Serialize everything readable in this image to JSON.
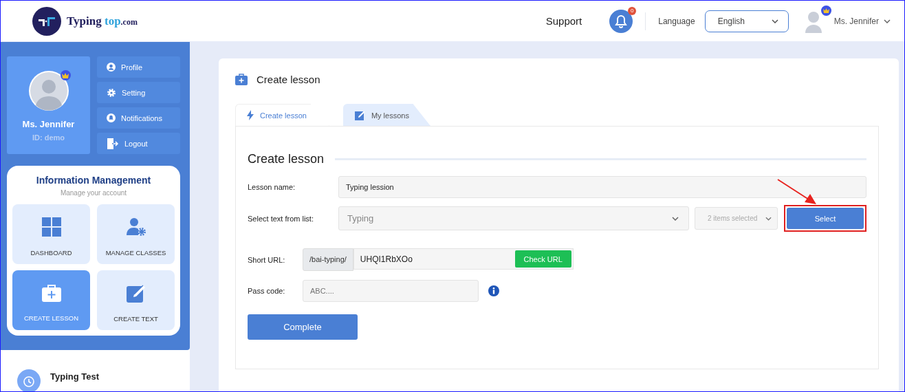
{
  "logo": {
    "part_1": "Typing",
    "part_2": "top",
    "part_3": ".com"
  },
  "header": {
    "support": "Support",
    "notification_count": "0",
    "language_label": "Language",
    "language": "English",
    "user_name": "Ms. Jennifer"
  },
  "profile": {
    "name": "Ms. Jennifer",
    "id": "ID: demo",
    "premium": true
  },
  "profile_menu": [
    {
      "label": "Profile",
      "kind": "user"
    },
    {
      "label": "Setting",
      "kind": "gear"
    },
    {
      "label": "Notifications",
      "kind": "bell"
    },
    {
      "label": "Logout",
      "kind": "logout"
    }
  ],
  "info_management": {
    "title": "Information Management",
    "subtitle": "Manage your account",
    "tiles": [
      {
        "label": "DASHBOARD",
        "kind": "grid",
        "selected": false
      },
      {
        "label": "MANAGE CLASSES",
        "kind": "user-gear",
        "selected": false
      },
      {
        "label": "CREATE LESSON",
        "kind": "kit",
        "selected": true
      },
      {
        "label": "CREATE TEXT",
        "kind": "edit",
        "selected": false
      }
    ]
  },
  "sidebar_link": {
    "title": "Typing Test"
  },
  "page": {
    "title": "Create lesson",
    "tabs": [
      {
        "label": "Create lesson",
        "kind": "bolt",
        "selected": true
      },
      {
        "label": "My lessons",
        "kind": "edit",
        "selected": false
      }
    ],
    "section_title": "Create lesson",
    "form": {
      "lesson_name": {
        "label": "Lesson name:",
        "value": "Typing lession"
      },
      "text_list": {
        "label": "Select text from list:",
        "value": "Typing",
        "selection": "2 items selected",
        "button": "Select",
        "highlighted": true
      },
      "short_url": {
        "label": "Short URL:",
        "prefix": "/bai-typing/",
        "value": "UHQI1RbXOo",
        "button": "Check URL"
      },
      "pass_code": {
        "label": "Pass code:",
        "placeholder": "ABC...."
      },
      "submit": "Complete"
    }
  }
}
